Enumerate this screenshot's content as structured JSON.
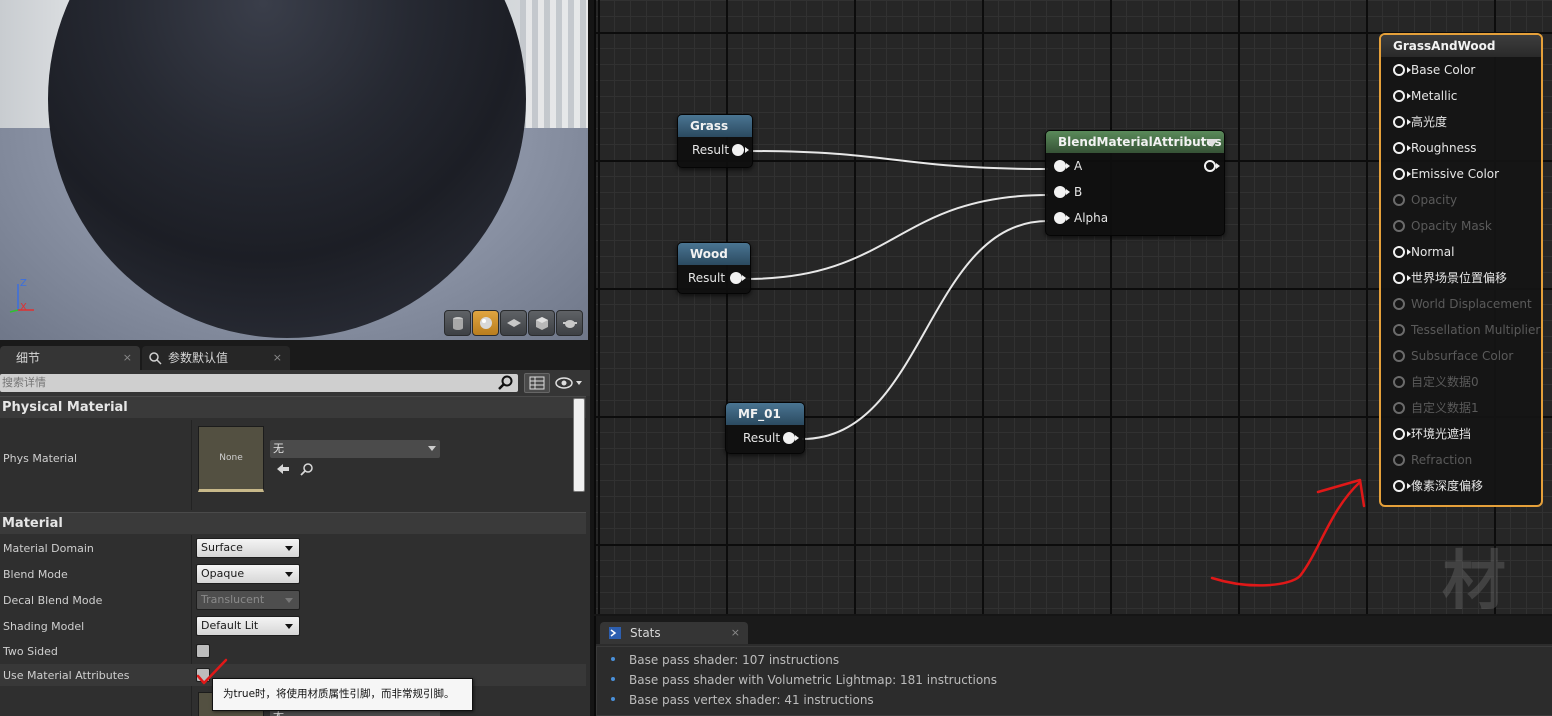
{
  "details_panel": {
    "tabs": [
      {
        "label": "细节",
        "close": "×"
      },
      {
        "label": "参数默认值",
        "close": "×"
      }
    ],
    "search_placeholder": "搜索详情",
    "sections": {
      "physical_material": {
        "title": "Physical Material",
        "phys_material_label": "Phys Material",
        "thumbnail_text": "None",
        "combo_value": "无"
      },
      "material": {
        "title": "Material",
        "rows": [
          {
            "label": "Material Domain",
            "value": "Surface"
          },
          {
            "label": "Blend Mode",
            "value": "Opaque"
          },
          {
            "label": "Decal Blend Mode",
            "value": "Translucent"
          },
          {
            "label": "Shading Model",
            "value": "Default Lit"
          },
          {
            "label": "Two Sided",
            "value": ""
          },
          {
            "label": "Use Material Attributes",
            "value": ""
          }
        ]
      }
    },
    "tooltip": "为true时，将使用材质属性引脚，而非常规引脚。",
    "partial_combo_text": "无"
  },
  "graph": {
    "nodes": {
      "grass": {
        "title": "Grass",
        "output": "Result"
      },
      "wood": {
        "title": "Wood",
        "output": "Result"
      },
      "mf01": {
        "title": "MF_01",
        "output": "Result"
      },
      "blend": {
        "title": "BlendMaterialAttributes",
        "inputs": [
          "A",
          "B",
          "Alpha"
        ]
      },
      "output": {
        "title": "GrassAndWood",
        "pins": [
          {
            "label": "Base Color",
            "enabled": true
          },
          {
            "label": "Metallic",
            "enabled": true
          },
          {
            "label": "高光度",
            "enabled": true
          },
          {
            "label": "Roughness",
            "enabled": true
          },
          {
            "label": "Emissive Color",
            "enabled": true
          },
          {
            "label": "Opacity",
            "enabled": false
          },
          {
            "label": "Opacity Mask",
            "enabled": false
          },
          {
            "label": "Normal",
            "enabled": true
          },
          {
            "label": "世界场景位置偏移",
            "enabled": true
          },
          {
            "label": "World Displacement",
            "enabled": false
          },
          {
            "label": "Tessellation Multiplier",
            "enabled": false
          },
          {
            "label": "Subsurface Color",
            "enabled": false
          },
          {
            "label": "自定义数据0",
            "enabled": false
          },
          {
            "label": "自定义数据1",
            "enabled": false
          },
          {
            "label": "环境光遮挡",
            "enabled": true
          },
          {
            "label": "Refraction",
            "enabled": false
          },
          {
            "label": "像素深度偏移",
            "enabled": true
          }
        ]
      }
    },
    "watermark": "材质"
  },
  "stats_panel": {
    "tab_label": "Stats",
    "tab_close": "×",
    "lines": [
      "Base pass shader: 107 instructions",
      "Base pass shader with Volumetric Lightmap: 181 instructions",
      "Base pass vertex shader: 41 instructions"
    ]
  },
  "viewport": {
    "axis_labels": {
      "z": "Z",
      "x": "X"
    }
  },
  "colors": {
    "output_node_border": "#e5a03a",
    "node_header_blue": "#3a5f78",
    "node_header_green": "#4a744a",
    "annotation_red": "#e01818"
  }
}
